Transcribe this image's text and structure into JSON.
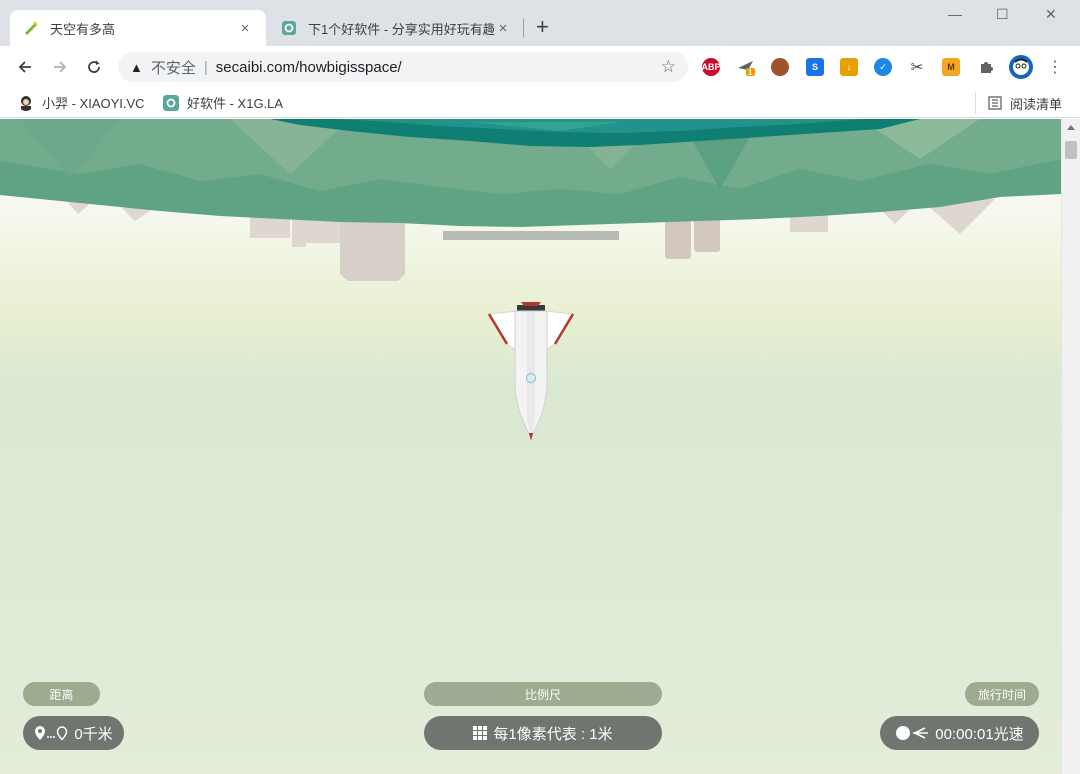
{
  "browser": {
    "tabs": [
      {
        "title": "天空有多高",
        "active": true,
        "icon": "ruler-icon"
      },
      {
        "title": "下1个好软件 - 分享实用好玩有趣",
        "active": false,
        "icon": "gear-icon"
      }
    ],
    "close_symbol": "×",
    "new_tab_symbol": "+",
    "window_controls": {
      "minimize": "—",
      "maximize": "☐",
      "close": "✕"
    },
    "address": {
      "security_label": "不安全",
      "url": "secaibi.com/howbigisspace/"
    },
    "extensions": [
      {
        "name": "adblock-plus-icon",
        "label": "ABP",
        "color": "#c70d2c"
      },
      {
        "name": "plane-extension-icon",
        "label": "1",
        "color": "#f29900"
      },
      {
        "name": "monkey-extension-icon",
        "label": "",
        "color": "#a0522d"
      },
      {
        "name": "s-extension-icon",
        "label": "S",
        "color": "#1a73e8"
      },
      {
        "name": "download-extension-icon",
        "label": "↓",
        "color": "#e8a000"
      },
      {
        "name": "cloud-extension-icon",
        "label": "✓",
        "color": "#1e88e5"
      },
      {
        "name": "scissors-extension-icon",
        "label": "✂",
        "color": "#ffffff"
      },
      {
        "name": "m-extension-icon",
        "label": "M",
        "color": "#f4a623"
      },
      {
        "name": "puzzle-icon",
        "label": "",
        "color": "#5f6368"
      }
    ],
    "bookmarks": [
      {
        "label": "小羿 - XIAOYI.VC",
        "icon": "avatar-icon"
      },
      {
        "label": "好软件 - X1G.LA",
        "icon": "gear-icon"
      }
    ],
    "reading_list": "阅读清单"
  },
  "hud": {
    "distance": {
      "label": "距离",
      "value": "0千米"
    },
    "scale": {
      "label": "比例尺",
      "value": "每1像素代表 : 1米"
    },
    "time": {
      "label": "旅行时间",
      "value": "00:00:01光速"
    }
  },
  "colors": {
    "mountain_dark": "#0f7f74",
    "mountain_mid": "#4e9c7d",
    "mountain_light": "#8fb89a",
    "building": "#ddd7cf",
    "hud_label_bg": "#9aa88e",
    "hud_value_bg": "#6f756f"
  }
}
